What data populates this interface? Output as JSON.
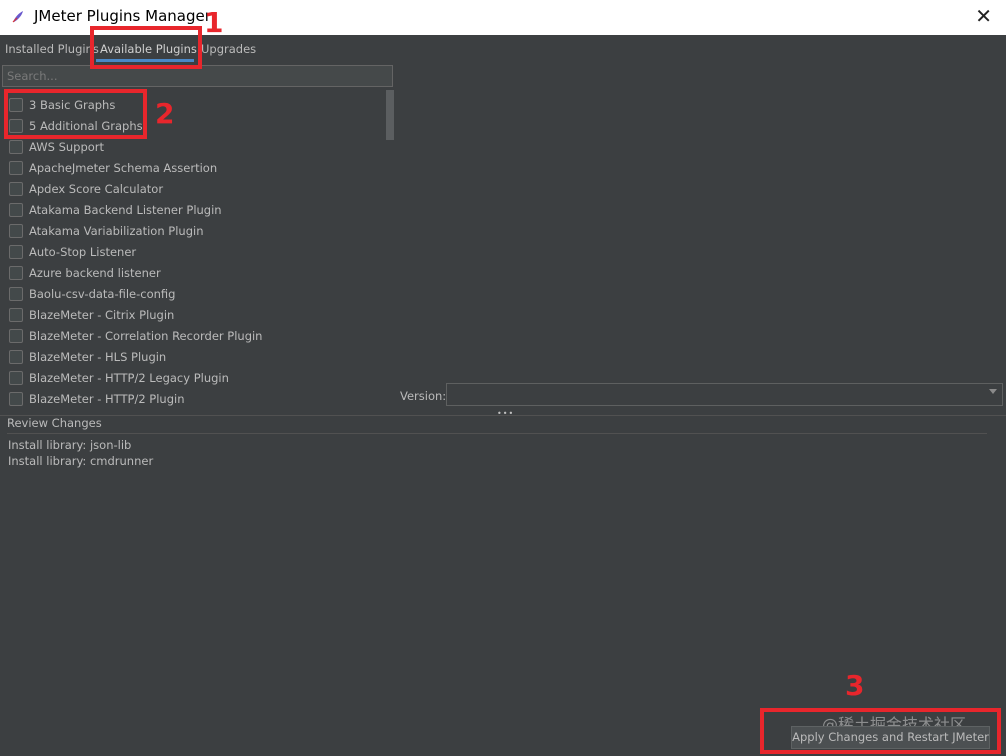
{
  "window": {
    "title": "JMeter Plugins Manager",
    "close_glyph": "✕"
  },
  "tabs": [
    {
      "label": "Installed Plugins"
    },
    {
      "label": "Available Plugins",
      "active": true
    },
    {
      "label": "Upgrades"
    }
  ],
  "search": {
    "placeholder": "Search..."
  },
  "plugins": [
    "3 Basic Graphs",
    "5 Additional Graphs",
    "AWS Support",
    "ApacheJmeter Schema Assertion",
    "Apdex Score Calculator",
    "Atakama Backend Listener Plugin",
    "Atakama Variabilization Plugin",
    "Auto-Stop Listener",
    "Azure backend listener",
    "Baolu-csv-data-file-config",
    "BlazeMeter - Citrix Plugin",
    "BlazeMeter - Correlation Recorder Plugin",
    "BlazeMeter - HLS Plugin",
    "BlazeMeter - HTTP/2 Legacy Plugin",
    "BlazeMeter - HTTP/2 Plugin"
  ],
  "version": {
    "label": "Version:",
    "value": ""
  },
  "review": {
    "header": "Review Changes",
    "lines": [
      "Install library: json-lib",
      "Install library: cmdrunner"
    ]
  },
  "apply_button": {
    "label": "Apply Changes and Restart JMeter"
  },
  "watermark": "@稀土掘金技术社区",
  "annotations": [
    "1",
    "2",
    "3"
  ],
  "colors": {
    "annotation": "#e8262c",
    "background": "#3c3f41",
    "tab_underline": "#4a88c7"
  }
}
